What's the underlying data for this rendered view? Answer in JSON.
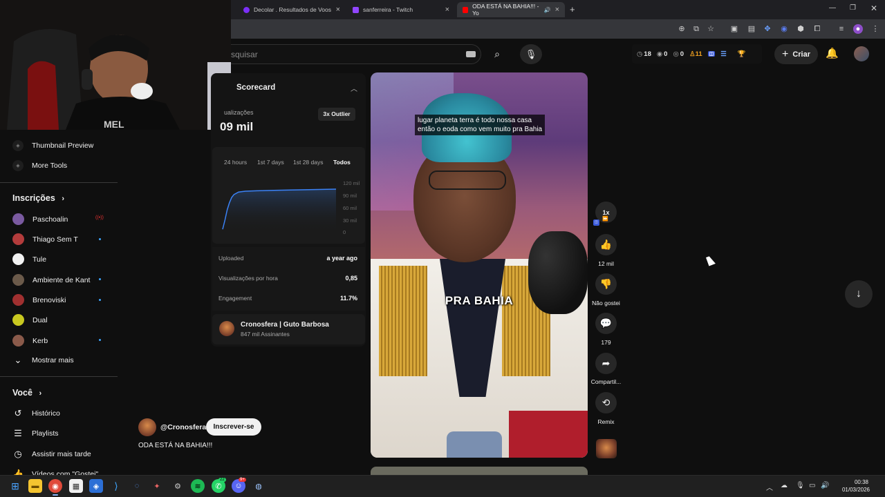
{
  "browser": {
    "tabs": [
      {
        "title": "Decolar . Resultados de Voos",
        "favicon_color": "#7b2ff7"
      },
      {
        "title": "sanferreira - Twitch",
        "favicon_color": "#9146ff"
      },
      {
        "title": "ODA ESTÁ NA BAHIA!!! - Yo",
        "favicon_color": "#ff0000",
        "active": true
      }
    ],
    "new_tab_icon": "+",
    "window_controls": [
      "minimize-icon",
      "restore-icon",
      "close-icon"
    ]
  },
  "header": {
    "search_placeholder": "squisar",
    "stats": {
      "clock": "18",
      "views": "0",
      "views2": "0",
      "person": "11"
    },
    "create_label": "Criar"
  },
  "sidebar": {
    "tools": [
      {
        "label": "Thumbnail Preview"
      },
      {
        "label": "More Tools"
      }
    ],
    "subscriptions_header": "Inscrições",
    "subscriptions": [
      {
        "label": "Paschoalin",
        "live": true,
        "color": "#7a5aa0"
      },
      {
        "label": "Thiago Sem T",
        "dot": true,
        "color": "#b33c3c"
      },
      {
        "label": "Tule",
        "dot": false,
        "color": "#f2f2f2"
      },
      {
        "label": "Ambiente de Kant",
        "dot": true,
        "color": "#6b5a4a"
      },
      {
        "label": "Brenoviski",
        "dot": true,
        "color": "#a03030"
      },
      {
        "label": "Dual",
        "dot": false,
        "color": "#c8c820"
      },
      {
        "label": "Kerb",
        "dot": true,
        "color": "#8a5a4a"
      }
    ],
    "show_more": "Mostrar mais",
    "you_header": "Você",
    "you_items": [
      {
        "label": "Histórico",
        "icon": "history-icon"
      },
      {
        "label": "Playlists",
        "icon": "playlist-icon"
      },
      {
        "label": "Assistir mais tarde",
        "icon": "clock-icon"
      },
      {
        "label": "Vídeos com \"Gostei\"",
        "icon": "thumbs-up-icon"
      }
    ]
  },
  "scorecard": {
    "title": "Scorecard",
    "views_label": "ualizações",
    "views_value": "09 mil",
    "outlier_badge": "3x Outlier",
    "ranges": [
      "24 hours",
      "1st 7 days",
      "1st 28 days",
      "Todos"
    ],
    "selected_range": "Todos",
    "y_ticks": [
      "120 mil",
      "90 mil",
      "60 mil",
      "30 mil",
      "0"
    ],
    "stats": [
      {
        "label": "Uploaded",
        "value": "a year ago"
      },
      {
        "label": "Visualizações por hora",
        "value": "0,85"
      },
      {
        "label": "Engagement",
        "value": "11.7%"
      }
    ],
    "channel_name": "Cronosfera | Guto Barbosa",
    "channel_subs": "847 mil Assinantes"
  },
  "chart_data": {
    "type": "area",
    "ylim": [
      0,
      120
    ],
    "y_ticks": [
      "120 mil",
      "90 mil",
      "60 mil",
      "30 mil",
      "0"
    ],
    "x": [
      0,
      2,
      4,
      6,
      8,
      10,
      14,
      20,
      30,
      45,
      60,
      80,
      100
    ],
    "values": [
      8,
      30,
      55,
      72,
      85,
      92,
      98,
      100,
      101,
      102,
      103,
      104,
      105
    ]
  },
  "video": {
    "subtitle_line1": "lugar planeta terra é todo nossa casa",
    "subtitle_line2": "então o eoda como vem muito pra Bahia",
    "overlay_text": "PRA BAHIA"
  },
  "actions": {
    "speed": "1x",
    "like_count": "12 mil",
    "dislike_label": "Não gostei",
    "comments_count": "179",
    "share_label": "Compartil...",
    "remix_label": "Remix"
  },
  "video_info": {
    "handle": "@Cronosfera",
    "subscribe_label": "Inscrever-se",
    "title": "ODA ESTÁ NA BAHIA!!!"
  },
  "taskbar": {
    "time": "00:38",
    "date": "01/03/2026",
    "badges": {
      "whatsapp": "22",
      "discord": "9+"
    }
  }
}
